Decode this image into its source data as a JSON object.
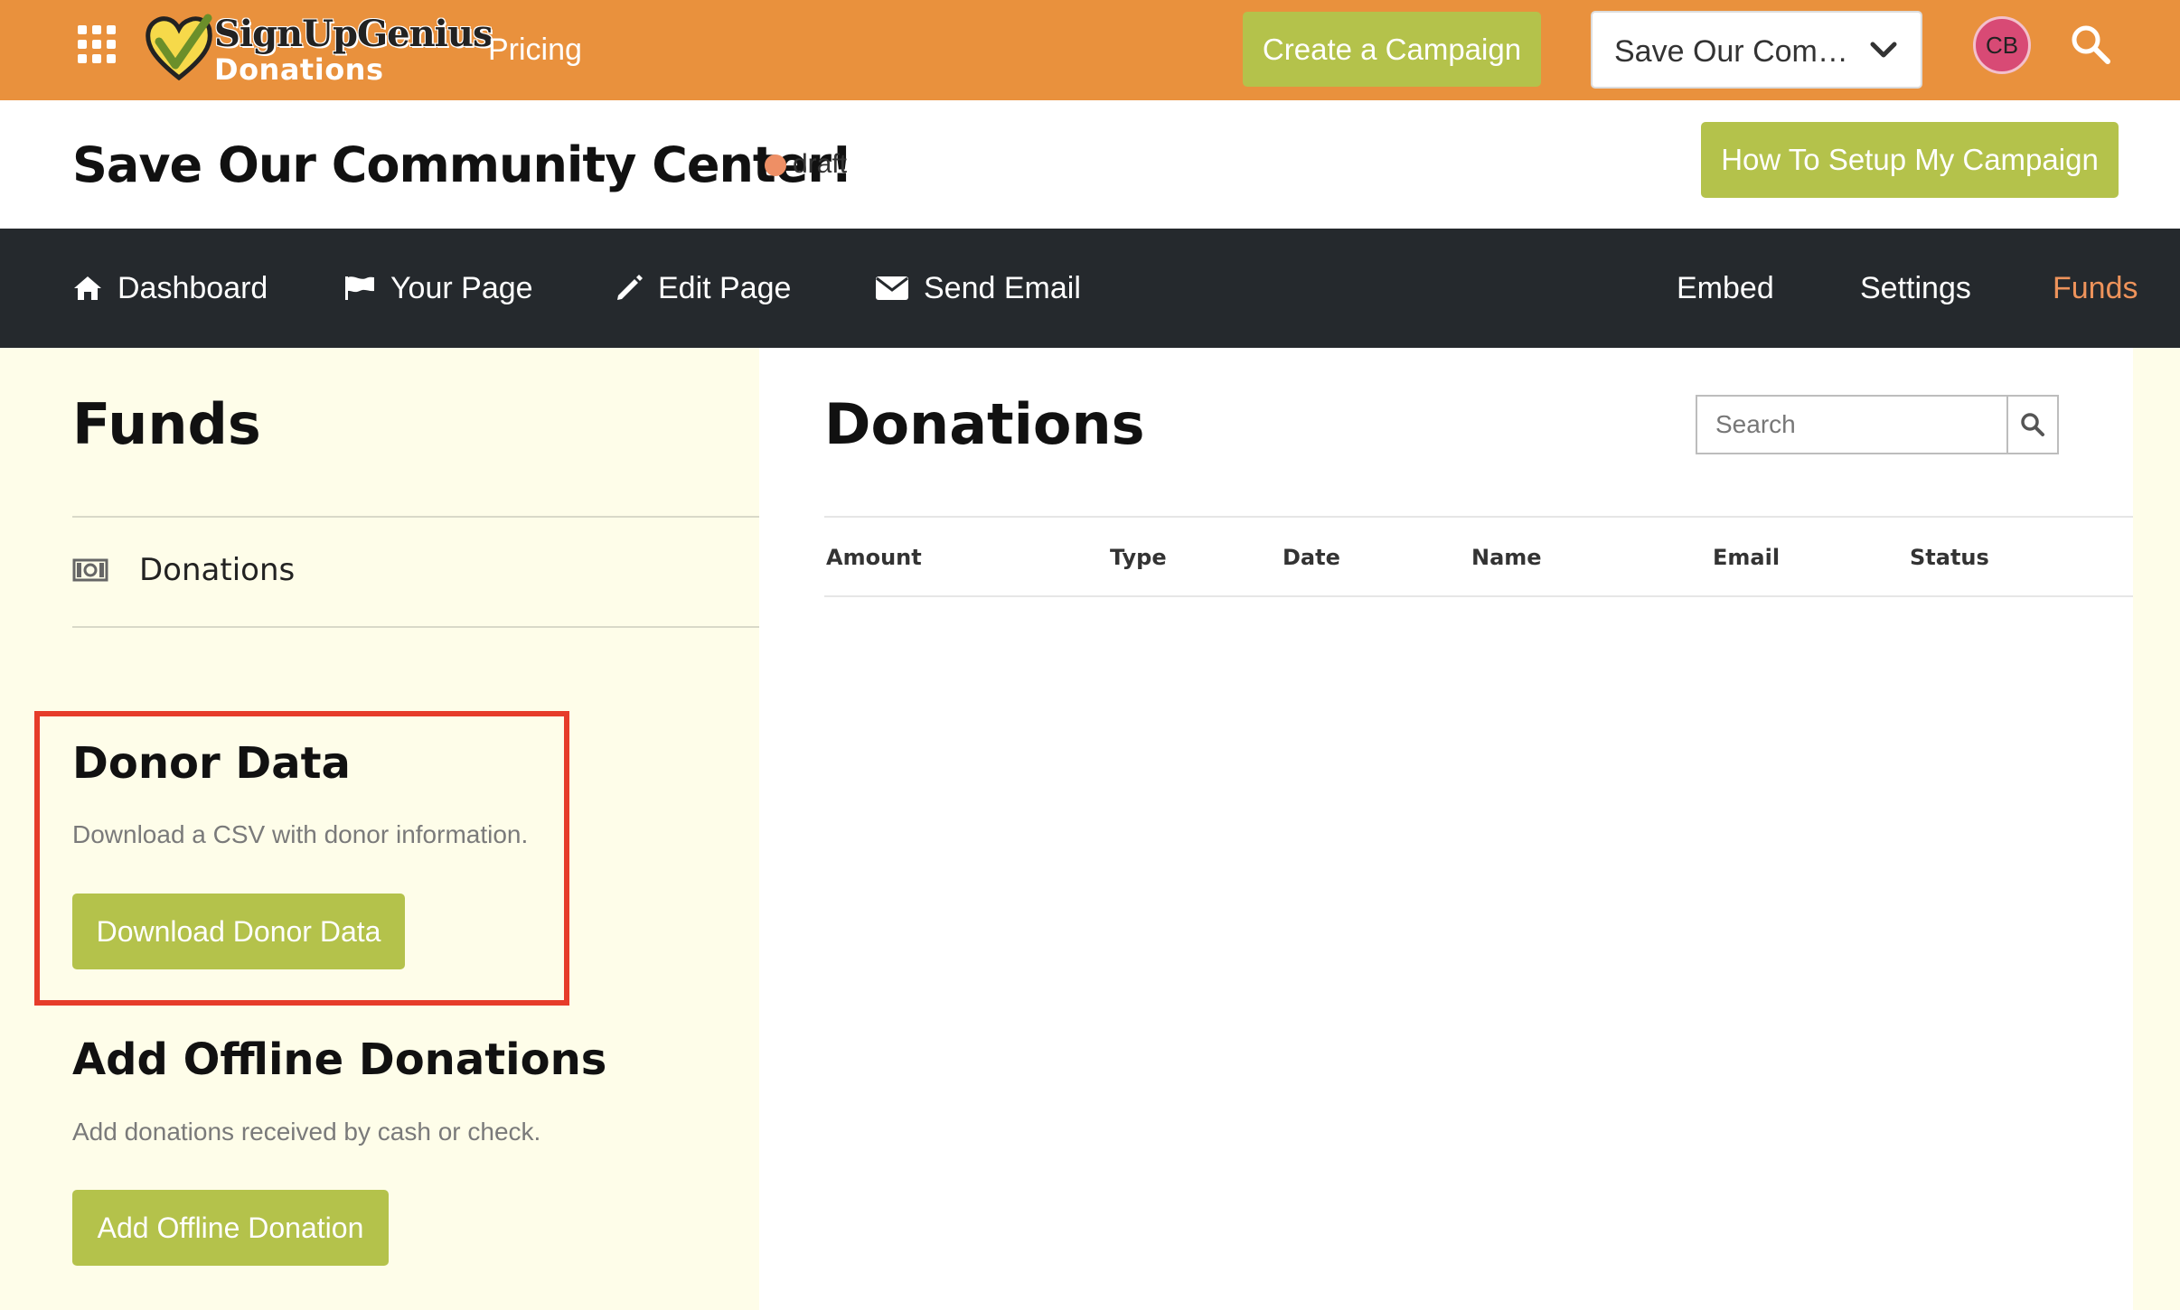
{
  "header": {
    "logo_top": "SignUpGenius",
    "logo_bottom": "Donations",
    "pricing_label": "Pricing",
    "create_campaign_label": "Create a Campaign",
    "campaign_selector_value": "Save Our Com…",
    "avatar_initials": "CB",
    "accent_color": "#e9913d",
    "button_color": "#b4c24b"
  },
  "title_row": {
    "title": "Save Our Community Center!",
    "status": "draft",
    "howto_label": "How To Setup My Campaign"
  },
  "nav": {
    "dashboard": "Dashboard",
    "your_page": "Your Page",
    "edit_page": "Edit Page",
    "send_email": "Send Email",
    "embed": "Embed",
    "settings": "Settings",
    "funds": "Funds",
    "active": "Funds"
  },
  "sidebar": {
    "title": "Funds",
    "donations_label": "Donations",
    "donor_data": {
      "heading": "Donor Data",
      "description": "Download a CSV with donor information.",
      "button": "Download Donor Data"
    },
    "offline": {
      "heading": "Add Offline Donations",
      "description": "Add donations received by cash or check.",
      "button": "Add Offline Donation"
    }
  },
  "main": {
    "title": "Donations",
    "search_placeholder": "Search",
    "columns": [
      "Amount",
      "Type",
      "Date",
      "Name",
      "Email",
      "Status"
    ]
  }
}
